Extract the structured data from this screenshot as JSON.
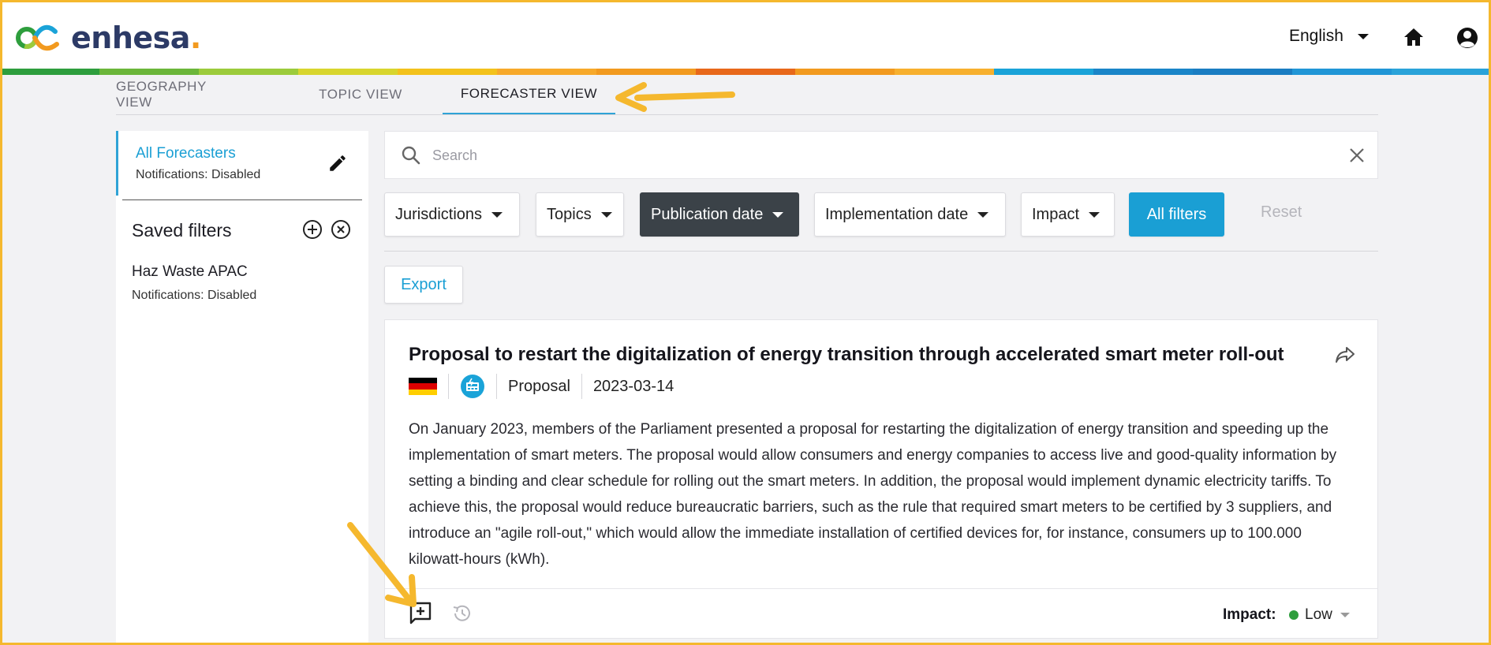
{
  "brand": {
    "logo_text": "enhesa",
    "logo_dot": ".",
    "strip_colors": [
      "#2e9e3d",
      "#6bb63a",
      "#9ccb3b",
      "#d8d52e",
      "#f3c21c",
      "#f7a92a",
      "#f29a1f",
      "#e8681a",
      "#f29a1f",
      "#f7b02e",
      "#1aa3d8",
      "#1a85c8",
      "#1a7dc2",
      "#2196d6",
      "#2aa3d9"
    ]
  },
  "header": {
    "language": "English",
    "icons": [
      "home-icon",
      "user-icon",
      "chevron-down-icon"
    ]
  },
  "tabs": [
    {
      "label": "GEOGRAPHY VIEW",
      "active": false
    },
    {
      "label": "TOPIC VIEW",
      "active": false
    },
    {
      "label": "FORECASTER VIEW",
      "active": true
    }
  ],
  "sidebar": {
    "all_forecasters": {
      "title": "All Forecasters",
      "notifications": "Notifications: Disabled"
    },
    "saved_filters_title": "Saved filters",
    "saved_filters": [
      {
        "title": "Haz Waste APAC",
        "notifications": "Notifications: Disabled"
      }
    ]
  },
  "search": {
    "placeholder": "Search",
    "value": ""
  },
  "filters": {
    "jurisdictions": "Jurisdictions",
    "topics": "Topics",
    "publication_date": "Publication date",
    "implementation_date": "Implementation date",
    "impact": "Impact",
    "all_filters": "All filters",
    "reset": "Reset"
  },
  "export_label": "Export",
  "card": {
    "title": "Proposal to restart the digitalization of energy transition through accelerated smart meter roll-out",
    "type": "Proposal",
    "date": "2023-03-14",
    "country_flag": "Germany",
    "body": "On January 2023, members of the Parliament presented a proposal for restarting the digitalization of energy transition and speeding up the implementation of smart meters. The proposal would allow consumers and energy companies to access live and good-quality information by setting a binding and clear schedule for rolling out the smart meters. In addition, the proposal would implement dynamic electricity tariffs. To achieve this, the proposal would reduce bureaucratic barriers, such as the rule that required smart meters to be certified by 3 suppliers, and introduce an \"agile roll-out,\" which would allow the immediate installation of certified devices for, for instance, consumers up to 100.000 kilowatt-hours (kWh).",
    "impact_label": "Impact:",
    "impact_value": "Low",
    "impact_color": "#2e9e3d"
  },
  "colors": {
    "accent": "#1a9fd4",
    "dark_button": "#3b4248",
    "annotation": "#f5b82e"
  }
}
